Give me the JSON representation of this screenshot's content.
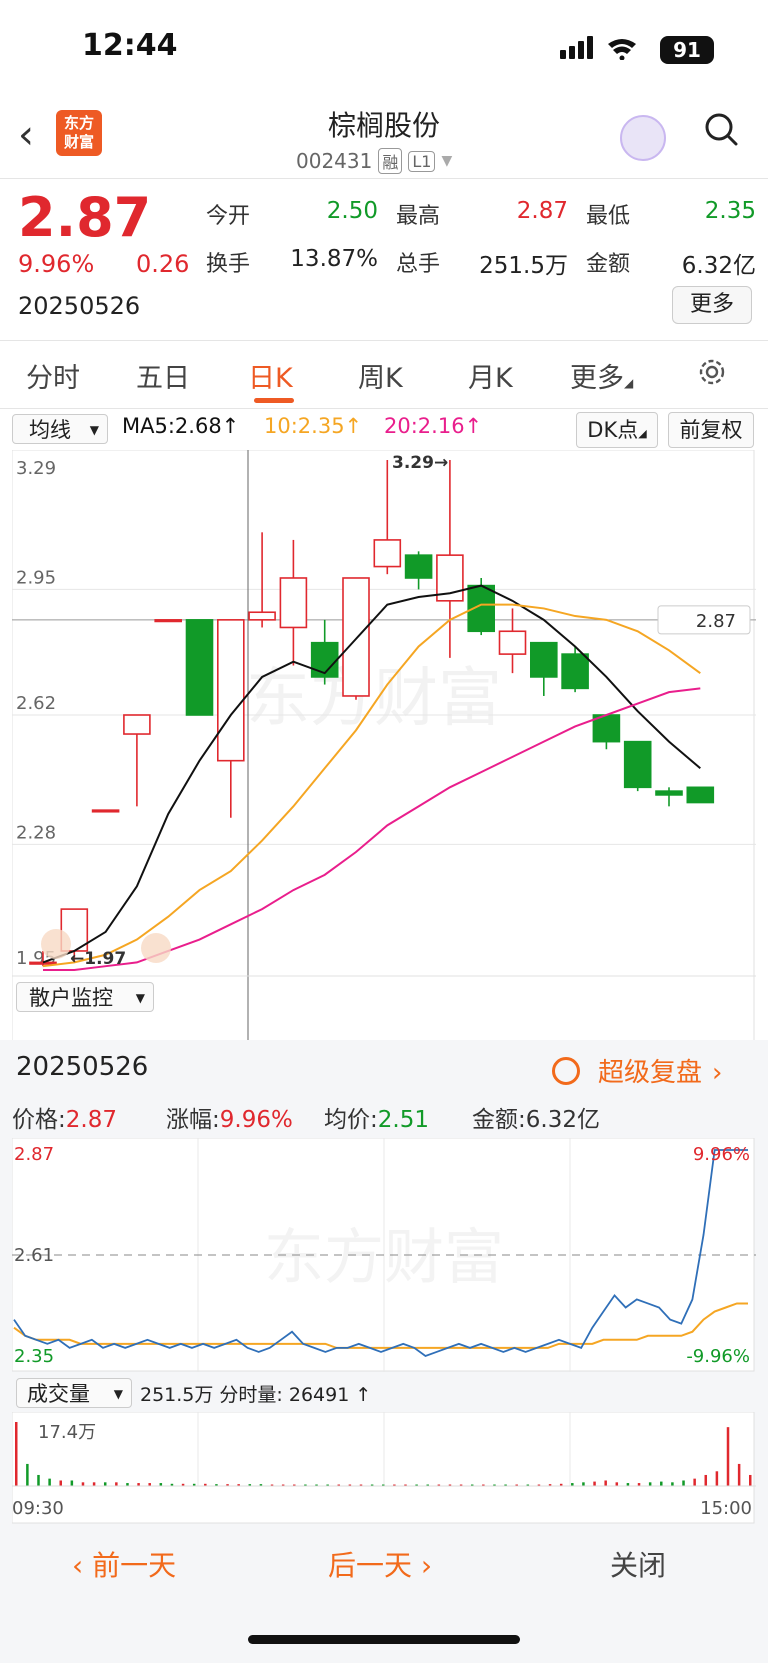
{
  "status_bar": {
    "time": "12:44",
    "battery": "91"
  },
  "header": {
    "logo_text_1": "东方",
    "logo_text_2": "财富",
    "stock_name": "棕榈股份",
    "stock_code": "002431",
    "tag1": "融",
    "tag2": "L1"
  },
  "quote": {
    "price": "2.87",
    "change_pct": "9.96%",
    "change": "0.26",
    "date": "20250526",
    "open_label": "今开",
    "open": "2.50",
    "high_label": "最高",
    "high": "2.87",
    "low_label": "最低",
    "low": "2.35",
    "turnover_label": "换手",
    "turnover": "13.87%",
    "volume_label": "总手",
    "volume": "251.5万",
    "amount_label": "金额",
    "amount": "6.32亿",
    "more_button": "更多"
  },
  "tabs": [
    "分时",
    "五日",
    "日K",
    "周K",
    "月K",
    "更多"
  ],
  "active_tab": "日K",
  "indicator_bar": {
    "ma_select": "均线",
    "ma5": "MA5:2.68↑",
    "ma10": "10:2.35↑",
    "ma20": "20:2.16↑",
    "dk_button": "DK点",
    "fq_button": "前复权"
  },
  "kline": {
    "y_ticks": [
      "3.29",
      "2.95",
      "2.62",
      "2.28",
      "1.95"
    ],
    "y_tick_values": [
      3.29,
      2.95,
      2.62,
      2.28,
      1.95
    ],
    "last_price_label": "2.87",
    "last_price": 2.87,
    "max_label": "3.29→",
    "min_label": "←1.97",
    "watermark": "东方财富",
    "monitor_select": "散户监控",
    "colors": {
      "up": "#e0282e",
      "down": "#119a28",
      "ma5": "#111111",
      "ma10": "#f5a623",
      "ma20": "#e91e8c"
    }
  },
  "chart_data": {
    "type": "candlestick",
    "ylim": [
      1.95,
      3.29
    ],
    "candles": [
      {
        "o": 1.97,
        "c": 1.97,
        "h": 2.0,
        "l": 1.96
      },
      {
        "o": 2.0,
        "c": 2.11,
        "h": 2.11,
        "l": 1.97
      },
      {
        "o": 2.37,
        "c": 2.37,
        "h": 2.37,
        "l": 2.37
      },
      {
        "o": 2.57,
        "c": 2.62,
        "h": 2.62,
        "l": 2.38
      },
      {
        "o": 2.87,
        "c": 2.87,
        "h": 2.87,
        "l": 2.87
      },
      {
        "o": 2.87,
        "c": 2.62,
        "h": 2.87,
        "l": 2.62
      },
      {
        "o": 2.5,
        "c": 2.87,
        "h": 2.87,
        "l": 2.35
      },
      {
        "o": 2.87,
        "c": 2.89,
        "h": 3.1,
        "l": 2.85
      },
      {
        "o": 2.85,
        "c": 2.98,
        "h": 3.08,
        "l": 2.75
      },
      {
        "o": 2.81,
        "c": 2.72,
        "h": 2.87,
        "l": 2.7
      },
      {
        "o": 2.67,
        "c": 2.98,
        "h": 2.98,
        "l": 2.66
      },
      {
        "o": 3.01,
        "c": 3.08,
        "h": 3.29,
        "l": 2.99
      },
      {
        "o": 3.04,
        "c": 2.98,
        "h": 3.05,
        "l": 2.95
      },
      {
        "o": 2.92,
        "c": 3.04,
        "h": 3.29,
        "l": 2.77
      },
      {
        "o": 2.96,
        "c": 2.84,
        "h": 2.98,
        "l": 2.83
      },
      {
        "o": 2.78,
        "c": 2.84,
        "h": 2.9,
        "l": 2.73
      },
      {
        "o": 2.81,
        "c": 2.72,
        "h": 2.81,
        "l": 2.67
      },
      {
        "o": 2.78,
        "c": 2.69,
        "h": 2.8,
        "l": 2.68
      },
      {
        "o": 2.62,
        "c": 2.55,
        "h": 2.62,
        "l": 2.53
      },
      {
        "o": 2.55,
        "c": 2.43,
        "h": 2.55,
        "l": 2.42
      },
      {
        "o": 2.42,
        "c": 2.41,
        "h": 2.43,
        "l": 2.38
      },
      {
        "o": 2.43,
        "c": 2.39,
        "h": 2.43,
        "l": 2.39
      }
    ],
    "ma5": [
      1.97,
      2.0,
      2.05,
      2.17,
      2.36,
      2.5,
      2.62,
      2.72,
      2.76,
      2.73,
      2.82,
      2.91,
      2.93,
      2.94,
      2.96,
      2.92,
      2.87,
      2.8,
      2.72,
      2.63,
      2.55,
      2.48
    ],
    "ma10": [
      1.96,
      1.97,
      1.99,
      2.03,
      2.09,
      2.16,
      2.21,
      2.29,
      2.38,
      2.48,
      2.58,
      2.7,
      2.8,
      2.87,
      2.91,
      2.91,
      2.9,
      2.88,
      2.87,
      2.84,
      2.79,
      2.73
    ],
    "ma20": [
      1.95,
      1.95,
      1.96,
      1.97,
      2.0,
      2.03,
      2.07,
      2.11,
      2.16,
      2.2,
      2.26,
      2.33,
      2.38,
      2.43,
      2.47,
      2.51,
      2.55,
      2.59,
      2.62,
      2.65,
      2.68,
      2.69
    ]
  },
  "lower_panel": {
    "date": "20250526",
    "replay_button": "超级复盘",
    "price_label": "价格:",
    "price": "2.87",
    "change_label": "涨幅:",
    "change": "9.96%",
    "avg_label": "均价:",
    "avg": "2.51",
    "amount_label": "金额:",
    "amount": "6.32亿",
    "y_top": "2.87",
    "y_mid": "2.61",
    "y_bottom": "2.35",
    "pct_top": "9.96%",
    "pct_bottom": "-9.96%",
    "watermark": "东方财富",
    "vol_select": "成交量",
    "vol_info": "251.5万 分时量: 26491 ↑",
    "vol_max": "17.4万",
    "time_start": "09:30",
    "time_end": "15:00"
  },
  "intraday": {
    "price": [
      2.45,
      2.41,
      2.4,
      2.39,
      2.4,
      2.38,
      2.39,
      2.4,
      2.38,
      2.39,
      2.38,
      2.39,
      2.4,
      2.39,
      2.38,
      2.39,
      2.38,
      2.39,
      2.38,
      2.39,
      2.4,
      2.38,
      2.37,
      2.38,
      2.4,
      2.42,
      2.39,
      2.38,
      2.37,
      2.38,
      2.38,
      2.39,
      2.38,
      2.37,
      2.38,
      2.39,
      2.38,
      2.36,
      2.37,
      2.38,
      2.39,
      2.38,
      2.39,
      2.38,
      2.37,
      2.38,
      2.37,
      2.38,
      2.39,
      2.4,
      2.39,
      2.38,
      2.43,
      2.47,
      2.51,
      2.48,
      2.5,
      2.49,
      2.48,
      2.45,
      2.44,
      2.5,
      2.66,
      2.87,
      2.87,
      2.87,
      2.87
    ],
    "avg": [
      2.43,
      2.41,
      2.4,
      2.4,
      2.4,
      2.4,
      2.39,
      2.39,
      2.39,
      2.39,
      2.39,
      2.39,
      2.39,
      2.39,
      2.39,
      2.39,
      2.39,
      2.39,
      2.39,
      2.39,
      2.39,
      2.39,
      2.39,
      2.39,
      2.39,
      2.39,
      2.39,
      2.39,
      2.39,
      2.38,
      2.38,
      2.38,
      2.38,
      2.38,
      2.38,
      2.38,
      2.38,
      2.38,
      2.38,
      2.38,
      2.38,
      2.38,
      2.38,
      2.38,
      2.38,
      2.38,
      2.38,
      2.38,
      2.38,
      2.39,
      2.39,
      2.39,
      2.39,
      2.4,
      2.4,
      2.4,
      2.4,
      2.41,
      2.41,
      2.41,
      2.41,
      2.42,
      2.45,
      2.47,
      2.48,
      2.49,
      2.49
    ],
    "volume": [
      17.4,
      6,
      3,
      2,
      1.5,
      1.5,
      1,
      1,
      1,
      1,
      0.8,
      0.8,
      0.8,
      0.8,
      0.6,
      0.6,
      0.6,
      0.6,
      0.5,
      0.5,
      0.5,
      0.5,
      0.5,
      0.4,
      0.4,
      0.4,
      0.4,
      0.4,
      0.4,
      0.4,
      0.4,
      0.4,
      0.4,
      0.4,
      0.4,
      0.4,
      0.4,
      0.4,
      0.4,
      0.4,
      0.4,
      0.4,
      0.4,
      0.4,
      0.4,
      0.4,
      0.4,
      0.4,
      0.5,
      0.6,
      0.8,
      1,
      1.2,
      1.5,
      1,
      0.8,
      0.8,
      1,
      1.2,
      1,
      1.5,
      2,
      3,
      4,
      16,
      6,
      3
    ],
    "y_range": [
      2.35,
      2.87
    ]
  },
  "bottom_nav": {
    "prev": "前一天",
    "next": "后一天",
    "close": "关闭"
  }
}
